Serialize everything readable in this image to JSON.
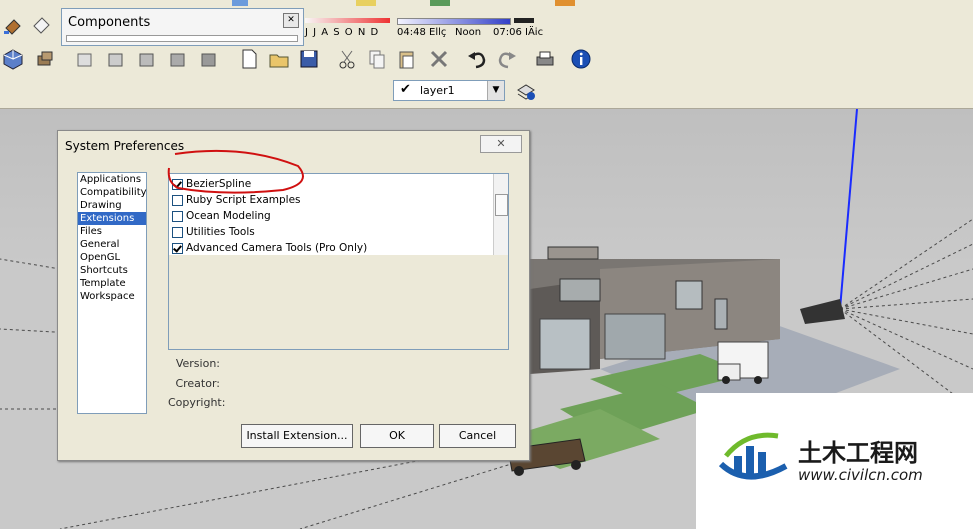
{
  "components_panel": {
    "title": "Components",
    "close_label": "✕"
  },
  "shadows": {
    "months": "J J A S O N D",
    "time_start": "04:48 Ellç",
    "noon": "Noon",
    "time_end": "07:06 IÄic"
  },
  "layers": {
    "check": "✔",
    "current": "layer1",
    "arrow": "▼"
  },
  "dialog": {
    "title": "System Preferences",
    "close_label": "✕",
    "categories": [
      "Applications",
      "Compatibility",
      "Drawing",
      "Extensions",
      "Files",
      "General",
      "OpenGL",
      "Shortcuts",
      "Template",
      "Workspace"
    ],
    "selected_category": "Extensions",
    "extensions": [
      {
        "label": "BezierSpline",
        "checked": true
      },
      {
        "label": "Ruby Script Examples",
        "checked": false
      },
      {
        "label": "Ocean Modeling",
        "checked": false
      },
      {
        "label": "Utilities Tools",
        "checked": false
      },
      {
        "label": "Advanced Camera Tools (Pro Only)",
        "checked": true
      }
    ],
    "version_label": "Version:",
    "creator_label": "Creator:",
    "copyright_label": "Copyright:",
    "install_button": "Install Extension...",
    "ok_button": "OK",
    "cancel_button": "Cancel"
  },
  "watermark": {
    "text_cn": "土木工程网",
    "url": "www.civilcn.com"
  },
  "colors": {
    "selection": "#3169c6",
    "annotation_circle": "#d01010",
    "axis_blue": "#1a2bff",
    "logo_blue": "#1b5fae",
    "logo_green": "#6fba2c"
  }
}
